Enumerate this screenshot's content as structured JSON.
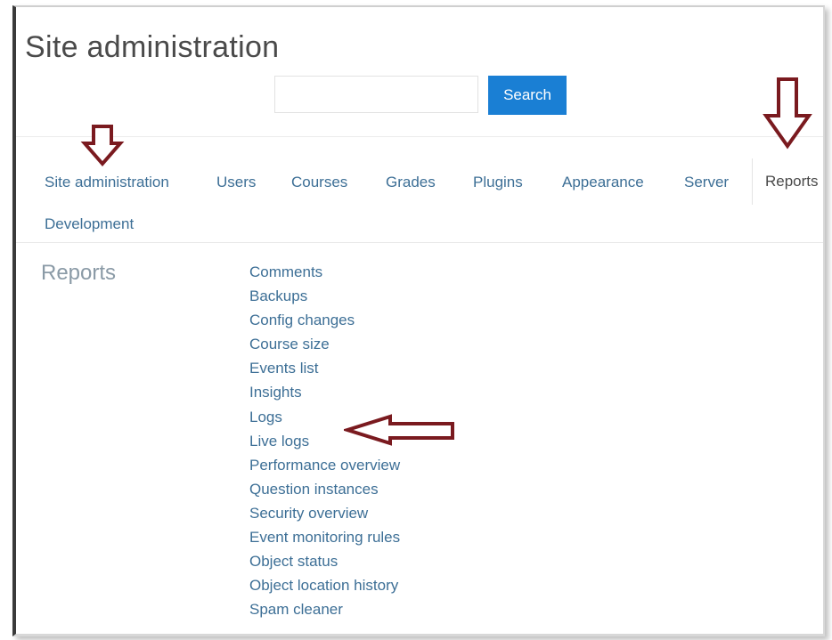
{
  "page": {
    "title": "Site administration"
  },
  "search": {
    "value": "",
    "placeholder": "",
    "button_label": "Search"
  },
  "tabs": [
    {
      "id": "site-administration",
      "label": "Site administration"
    },
    {
      "id": "users",
      "label": "Users"
    },
    {
      "id": "courses",
      "label": "Courses"
    },
    {
      "id": "grades",
      "label": "Grades"
    },
    {
      "id": "plugins",
      "label": "Plugins"
    },
    {
      "id": "appearance",
      "label": "Appearance"
    },
    {
      "id": "server",
      "label": "Server"
    },
    {
      "id": "reports",
      "label": "Reports",
      "active": true
    },
    {
      "id": "development",
      "label": "Development"
    }
  ],
  "section": {
    "heading": "Reports"
  },
  "reports": [
    "Comments",
    "Backups",
    "Config changes",
    "Course size",
    "Events list",
    "Insights",
    "Logs",
    "Live logs",
    "Performance overview",
    "Question instances",
    "Security overview",
    "Event monitoring rules",
    "Object status",
    "Object location history",
    "Spam cleaner"
  ],
  "annotations": {
    "arrow_color": "#7a1a1f",
    "arrows": [
      "down-arrow-icon",
      "down-arrow-icon",
      "left-arrow-icon"
    ]
  },
  "colors": {
    "link": "#3d6f96",
    "button": "#1a7fd4",
    "title": "#4a4a4a",
    "heading": "#8a9aa6"
  }
}
